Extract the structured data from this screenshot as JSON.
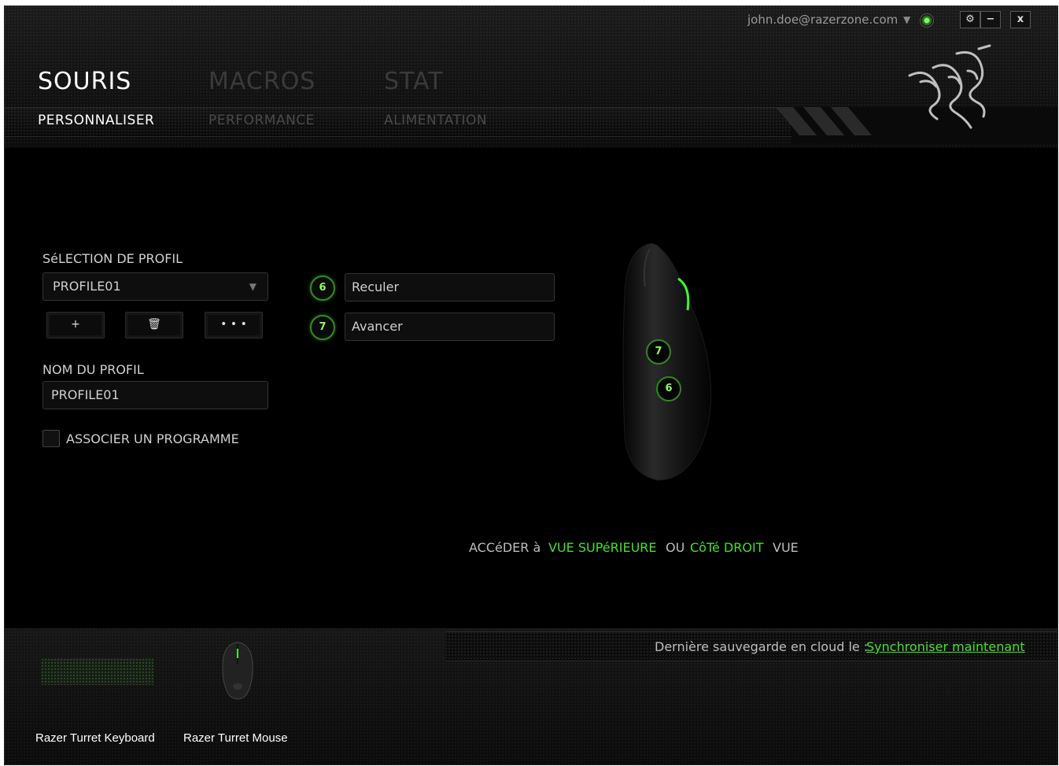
{
  "account": {
    "email": "john.doe@razerzone.com"
  },
  "window_controls": {
    "settings": "⚙",
    "minimize": "−",
    "close": "x"
  },
  "tabs_main": [
    "SOURIS",
    "MACROS",
    "STAT"
  ],
  "tabs_sub": [
    "PERSONNALISER",
    "PERFORMANCE",
    "ALIMENTATION"
  ],
  "profile": {
    "selection_label": "SéLECTION DE PROFIL",
    "selected": "PROFILE01",
    "add_label": "+",
    "delete_label": "🗑",
    "more_label": "• • •",
    "name_label": "NOM DU PROFIL",
    "name_value": "PROFILE01",
    "associate_label": "ASSOCIER UN PROGRAMME"
  },
  "buttons": [
    {
      "number": "6",
      "action": "Reculer"
    },
    {
      "number": "7",
      "action": "Avancer"
    }
  ],
  "view_nav": {
    "prefix": "ACCéDER à",
    "top_view": "VUE SUPéRIEURE",
    "or": "OU",
    "right_side": "CôTé DROIT",
    "suffix": "VUE"
  },
  "cloud": {
    "last_saved_label": "Dernière sauvegarde en cloud le :",
    "sync_link": "Synchroniser maintenant"
  },
  "devices": [
    "Razer Turret Keyboard",
    "Razer Turret Mouse"
  ],
  "colors": {
    "accent": "#44e02a",
    "background": "#000000"
  }
}
